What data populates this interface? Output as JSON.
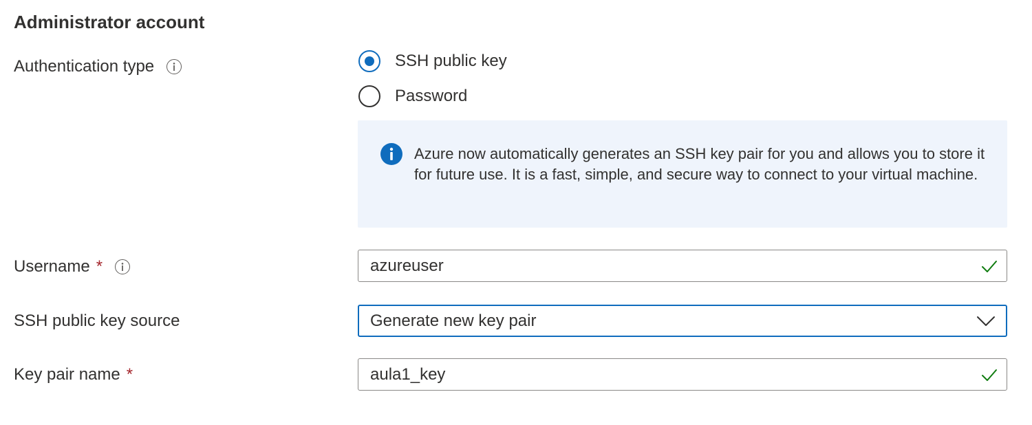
{
  "section": {
    "title": "Administrator account"
  },
  "auth_type": {
    "label": "Authentication type",
    "info_icon": "info-icon",
    "options": [
      {
        "label": "SSH public key",
        "checked": true
      },
      {
        "label": "Password",
        "checked": false
      }
    ]
  },
  "info_banner": {
    "icon": "info-filled-icon",
    "text": "Azure now automatically generates an SSH key pair for you and allows you to store it for future use. It is a fast, simple, and secure way to connect to your virtual machine."
  },
  "username": {
    "label": "Username",
    "required_mark": "*",
    "value": "azureuser",
    "info_icon": "info-icon",
    "status_icon": "checkmark-icon"
  },
  "ssh_key_source": {
    "label": "SSH public key source",
    "selected": "Generate new key pair",
    "icon": "chevron-down-icon"
  },
  "key_pair_name": {
    "label": "Key pair name",
    "required_mark": "*",
    "value": "aula1_key",
    "status_icon": "checkmark-icon"
  },
  "colors": {
    "accent": "#0f6cbd",
    "required": "#a4262c",
    "success": "#107c10",
    "banner_bg": "#eff4fc",
    "text": "#323130",
    "border": "#8a8886"
  }
}
